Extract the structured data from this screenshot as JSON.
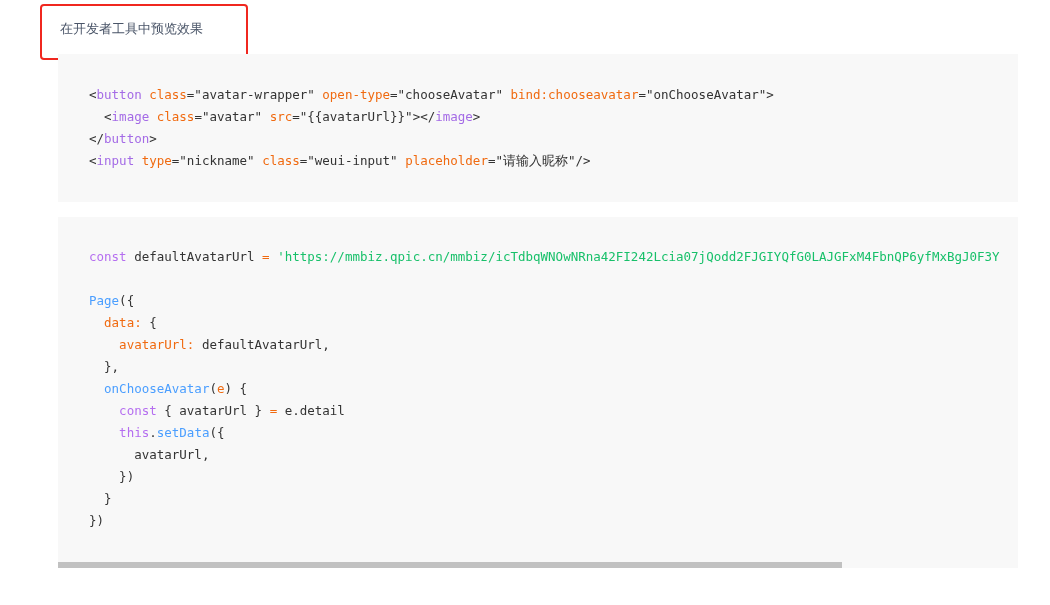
{
  "note": {
    "text": "在开发者工具中预览效果",
    "highlighted": true
  },
  "code_blocks": [
    {
      "scrollbar": false,
      "lines": [
        {
          "kind": "code",
          "tokens": [
            {
              "kind": "punct",
              "text": "<"
            },
            {
              "kind": "tag",
              "text": "button"
            },
            {
              "kind": "attr",
              "text": " class"
            },
            {
              "kind": "punct",
              "text": "=\"avatar-wrapper\" "
            },
            {
              "kind": "attr",
              "text": "open-type"
            },
            {
              "kind": "punct",
              "text": "=\"chooseAvatar\" "
            },
            {
              "kind": "attr",
              "text": "bind:chooseavatar"
            },
            {
              "kind": "punct",
              "text": "=\"onChooseAvatar\">"
            }
          ]
        },
        {
          "kind": "code",
          "tokens": [
            {
              "kind": "punct",
              "text": "  <"
            },
            {
              "kind": "tag",
              "text": "image"
            },
            {
              "kind": "attr",
              "text": " class"
            },
            {
              "kind": "punct",
              "text": "=\"avatar\" "
            },
            {
              "kind": "attr",
              "text": "src"
            },
            {
              "kind": "punct",
              "text": "=\"{{avatarUrl}}\"></"
            },
            {
              "kind": "tag",
              "text": "image"
            },
            {
              "kind": "punct",
              "text": ">"
            }
          ]
        },
        {
          "kind": "code",
          "tokens": [
            {
              "kind": "punct",
              "text": "</"
            },
            {
              "kind": "tag",
              "text": "button"
            },
            {
              "kind": "punct",
              "text": ">"
            }
          ]
        },
        {
          "kind": "code",
          "tokens": [
            {
              "kind": "punct",
              "text": "<"
            },
            {
              "kind": "tag",
              "text": "input"
            },
            {
              "kind": "attr",
              "text": " type"
            },
            {
              "kind": "punct",
              "text": "=\"nickname\" "
            },
            {
              "kind": "attr",
              "text": "class"
            },
            {
              "kind": "punct",
              "text": "=\"weui-input\" "
            },
            {
              "kind": "attr",
              "text": "placeholder"
            },
            {
              "kind": "punct",
              "text": "=\"请输入昵称\"/>"
            }
          ]
        }
      ]
    },
    {
      "scrollbar": true,
      "lines": [
        {
          "kind": "code",
          "tokens": [
            {
              "kind": "keyword",
              "text": "const"
            },
            {
              "kind": "plain",
              "text": " defaultAvatarUrl "
            },
            {
              "kind": "attr",
              "text": "="
            },
            {
              "kind": "string",
              "text": " 'https://mmbiz.qpic.cn/mmbiz/icTdbqWNOwNRna42FI242Lcia07jQodd2FJGIYQfG0LAJGFxM4FbnQP6yfMxBgJ0F3Y"
            }
          ]
        },
        {
          "kind": "blank"
        },
        {
          "kind": "code",
          "tokens": [
            {
              "kind": "func",
              "text": "Page"
            },
            {
              "kind": "plain",
              "text": "({"
            }
          ]
        },
        {
          "kind": "code",
          "tokens": [
            {
              "kind": "attr",
              "text": "  data:"
            },
            {
              "kind": "plain",
              "text": " {"
            }
          ]
        },
        {
          "kind": "code",
          "tokens": [
            {
              "kind": "attr",
              "text": "    avatarUrl:"
            },
            {
              "kind": "plain",
              "text": " defaultAvatarUrl,"
            }
          ]
        },
        {
          "kind": "code",
          "tokens": [
            {
              "kind": "plain",
              "text": "  },"
            }
          ]
        },
        {
          "kind": "code",
          "tokens": [
            {
              "kind": "func",
              "text": "  onChooseAvatar"
            },
            {
              "kind": "plain",
              "text": "("
            },
            {
              "kind": "attr",
              "text": "e"
            },
            {
              "kind": "plain",
              "text": ") {"
            }
          ]
        },
        {
          "kind": "code",
          "tokens": [
            {
              "kind": "keyword",
              "text": "    const"
            },
            {
              "kind": "plain",
              "text": " { avatarUrl } "
            },
            {
              "kind": "attr",
              "text": "="
            },
            {
              "kind": "plain",
              "text": " e.detail"
            }
          ]
        },
        {
          "kind": "code",
          "tokens": [
            {
              "kind": "keyword",
              "text": "    this"
            },
            {
              "kind": "plain",
              "text": "."
            },
            {
              "kind": "func",
              "text": "setData"
            },
            {
              "kind": "plain",
              "text": "({"
            }
          ]
        },
        {
          "kind": "code",
          "tokens": [
            {
              "kind": "plain",
              "text": "      avatarUrl,"
            }
          ]
        },
        {
          "kind": "code",
          "tokens": [
            {
              "kind": "plain",
              "text": "    })"
            }
          ]
        },
        {
          "kind": "code",
          "tokens": [
            {
              "kind": "plain",
              "text": "  }"
            }
          ]
        },
        {
          "kind": "code",
          "tokens": [
            {
              "kind": "plain",
              "text": "})"
            }
          ]
        }
      ]
    }
  ]
}
